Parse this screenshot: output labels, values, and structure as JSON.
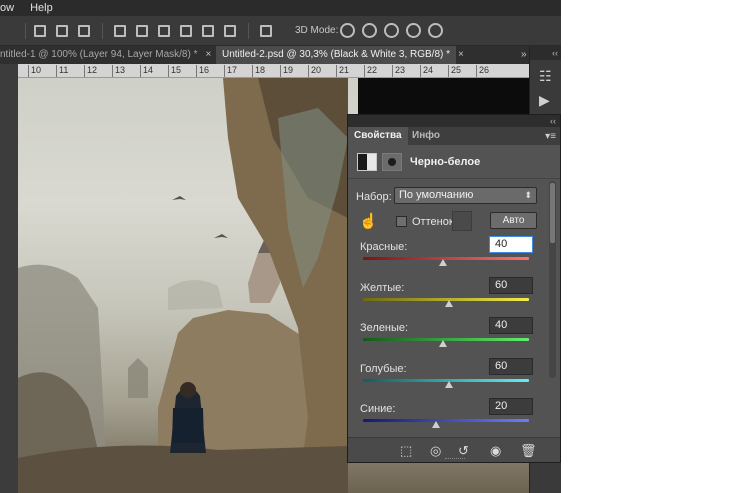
{
  "menu": {
    "items": [
      "ow",
      "Help"
    ]
  },
  "options_bar": {
    "mode_3d_label": "3D Mode:"
  },
  "tabs": [
    {
      "label": "ntitled-1 @ 100% (Layer 94, Layer Mask/8) *",
      "close": "×"
    },
    {
      "label": "Untitled-2.psd @ 30,3% (Black & White 3, RGB/8) *",
      "close": "×"
    }
  ],
  "tabs_more": "»",
  "ruler": {
    "ticks": [
      "10",
      "11",
      "12",
      "13",
      "14",
      "15",
      "16",
      "17",
      "18",
      "19",
      "20",
      "21",
      "22",
      "23",
      "24",
      "25",
      "26"
    ]
  },
  "strip": {
    "collapse": "‹‹"
  },
  "panel": {
    "collapse": "‹‹",
    "tabs": [
      "Свойства",
      "Инфо"
    ],
    "title": "Черно-белое",
    "preset_label": "Набор:",
    "preset_value": "По умолчанию",
    "tint_label": "Оттенок",
    "auto_label": "Авто",
    "sliders": [
      {
        "label": "Красные:",
        "value": "40",
        "focused": true,
        "from": "#7a1414",
        "to": "#ff7070",
        "pos": 0.48
      },
      {
        "label": "Желтые:",
        "value": "60",
        "focused": false,
        "from": "#6e6a10",
        "to": "#f2ee4a",
        "pos": 0.52
      },
      {
        "label": "Зеленые:",
        "value": "40",
        "focused": false,
        "from": "#155818",
        "to": "#5ef06a",
        "pos": 0.48
      },
      {
        "label": "Голубые:",
        "value": "60",
        "focused": false,
        "from": "#0f5f60",
        "to": "#5ff0f2",
        "pos": 0.52
      },
      {
        "label": "Синие:",
        "value": "20",
        "focused": false,
        "from": "#141a70",
        "to": "#6b7cff",
        "pos": 0.44
      }
    ]
  }
}
